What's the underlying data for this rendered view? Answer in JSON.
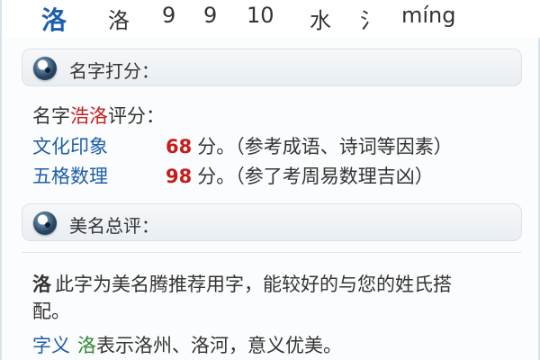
{
  "top_row": {
    "char_large": "洛",
    "char_small": "洛",
    "stroke1": "9",
    "stroke2": "9",
    "stroke3": "10",
    "element": "水",
    "radical": "氵",
    "pinyin": "míng"
  },
  "score_section": {
    "title": "名字打分：",
    "heading_prefix": "名字",
    "heading_name": "浩洛",
    "heading_suffix": "评分：",
    "rows": [
      {
        "label": "文化印象",
        "score": "68",
        "unit": "分。",
        "note": "（参考成语、诗词等因素）"
      },
      {
        "label": "五格数理",
        "score": "98",
        "unit": "分。",
        "note": "（参了考周易数理吉凶）"
      }
    ]
  },
  "review_section": {
    "title": "美名总评：",
    "char": "洛",
    "desc_line1": "此字为美名腾推荐用字，能较好的与您的姓氏搭",
    "desc_line2": "配。",
    "meaning_label": "字义",
    "meaning_char": "洛",
    "meaning_text": "表示洛州、洛河，意义优美。"
  },
  "colors": {
    "blue": "#1e5ea8",
    "red": "#c71c1c",
    "green": "#2d8a2d"
  },
  "icons": {
    "section": "eye-orb-icon"
  }
}
